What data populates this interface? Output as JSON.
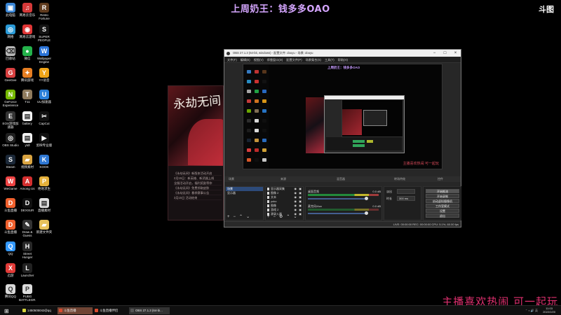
{
  "overlay": {
    "title": "上周奶王：钱多多OAO",
    "brand": "斗图",
    "footer": "主播喜欢热闹 可一起玩"
  },
  "desktop_icons": [
    {
      "label": "此电脑",
      "color": "#3b87d6",
      "icon": "computer-icon"
    },
    {
      "label": "网易云音乐",
      "color": "#d53939",
      "icon": "music-icon"
    },
    {
      "label": "Resto Fortune",
      "color": "#5f3b1e",
      "icon": "game-icon"
    },
    {
      "label": "网络",
      "color": "#2b9bd8",
      "icon": "network-icon"
    },
    {
      "label": "网易云游戏",
      "color": "#e03636",
      "icon": "cloud-game-icon"
    },
    {
      "label": "SUPER PEOPLE CBT",
      "color": "#141414",
      "icon": "game-icon"
    },
    {
      "label": "回收站",
      "color": "#b7b7b7",
      "icon": "recycle-bin-icon"
    },
    {
      "label": "微信",
      "color": "#24b24b",
      "icon": "wechat-icon"
    },
    {
      "label": "Wallpaper Engine",
      "color": "#2b73d6",
      "icon": "wallpaper-icon"
    },
    {
      "label": "GeeGee",
      "color": "#d84040",
      "icon": "app-icon"
    },
    {
      "label": "腾讯游戏",
      "color": "#e67e22",
      "icon": "game-icon"
    },
    {
      "label": "YY语音",
      "color": "#f0a518",
      "icon": "voice-icon"
    },
    {
      "label": "GeForce Experience",
      "color": "#76b900",
      "icon": "nvidia-icon"
    },
    {
      "label": "T11",
      "color": "#8f7b5d",
      "icon": "app-icon"
    },
    {
      "label": "UU加速器",
      "color": "#2a7fd8",
      "icon": "accelerator-icon"
    },
    {
      "label": "EOS游戏加速器",
      "color": "#333",
      "icon": "accelerator-icon"
    },
    {
      "label": "battery",
      "color": "#f2f2f2",
      "icon": "file-icon"
    },
    {
      "label": "CapCut",
      "color": "#111",
      "icon": "video-icon"
    },
    {
      "label": "OBS Studio",
      "color": "#202020",
      "icon": "obs-icon"
    },
    {
      "label": "ytdl",
      "color": "#f2f2f2",
      "icon": "file-icon"
    },
    {
      "label": "剪映专业版",
      "color": "#111",
      "icon": "video-icon"
    },
    {
      "label": "Steam",
      "color": "#1b2838",
      "icon": "steam-icon"
    },
    {
      "label": "视频素材",
      "color": "#d9a441",
      "icon": "folder-icon"
    },
    {
      "label": "KOOK",
      "color": "#2e77d3",
      "icon": "chat-icon"
    },
    {
      "label": "WeGame",
      "color": "#e44",
      "icon": "game-icon"
    },
    {
      "label": "Among Us",
      "color": "#d32f2f",
      "icon": "game-icon"
    },
    {
      "label": "绝地求生",
      "color": "#e5b13b",
      "icon": "game-icon"
    },
    {
      "label": "斗鱼直播",
      "color": "#f0602d",
      "icon": "live-icon"
    },
    {
      "label": "DEXSUR",
      "color": "#111",
      "icon": "game-icon"
    },
    {
      "label": "直播素材",
      "color": "#ddd",
      "icon": "file-icon"
    },
    {
      "label": "斗鱼直播",
      "color": "#f0602d",
      "icon": "live-icon"
    },
    {
      "label": "Draw & Guess",
      "color": "#333",
      "icon": "game-icon"
    },
    {
      "label": "新建文件夹",
      "color": "#e7c15b",
      "icon": "folder-icon"
    },
    {
      "label": "QQ",
      "color": "#3399ff",
      "icon": "qq-icon"
    },
    {
      "label": "Street Hunger",
      "color": "#282828",
      "icon": "game-icon"
    },
    {
      "label": "迅游",
      "color": "#e23b38",
      "icon": "accelerator-icon"
    },
    {
      "label": "Launcher",
      "color": "#222",
      "icon": "launcher-icon"
    },
    {
      "label": "腾讯QQ",
      "color": "#d9d9d9",
      "icon": "qq-icon"
    },
    {
      "label": "PUBG BATTLEGR...",
      "color": "#ddd",
      "icon": "game-icon"
    }
  ],
  "poster": {
    "calligraphy": "永劫无间",
    "lines": [
      "《永劫无间》新版本活动开启",
      "2月15日：新英雄、新武器上线",
      "全服活动开启，福利奖励等你",
      "《永劫无间》免费领取皮肤",
      "《永劫无间》春季赛事公告",
      "3月15日 活动结束"
    ]
  },
  "obs": {
    "title": "OBS 27.1.3 (64-bit, windows) - 配置文件: douyu - 场景: douyu",
    "menu": [
      "文件(F)",
      "编辑(E)",
      "视图(V)",
      "停靠窗口(D)",
      "配置文件(P)",
      "场景集合(S)",
      "工具(T)",
      "帮助(H)"
    ],
    "dock_titles": {
      "scenes": "场景",
      "sources": "来源",
      "mixer": "混音器",
      "transitions": "转场特效",
      "controls": "控件"
    },
    "scenes": [
      "场景",
      "显示器"
    ],
    "sources": [
      "显示器采集",
      "图像 2",
      "文本",
      "yoko",
      "图像",
      "游戏 2",
      "源录入器"
    ],
    "mixer": [
      {
        "name": "桌面音频",
        "db": "0.0 dB"
      },
      {
        "name": "麦克风/Aux",
        "db": "0.0 dB"
      }
    ],
    "transition": {
      "type_label": "淡出",
      "duration_label": "时长",
      "duration": "300 ms"
    },
    "controls": [
      "开始推流",
      "开始录制",
      "启动虚拟摄像机",
      "工作室模式",
      "设置",
      "退出"
    ],
    "status": "LIVE: 00:00:00   REC: 00:00:00   CPU: 5.1%, 60.00 fps"
  },
  "taskbar": {
    "items": [
      {
        "label": "1450505042@qq",
        "color": "#d6d33c"
      },
      {
        "label": "斗鱼直播",
        "color": "#d84b2f"
      },
      {
        "label": "斗鱼直播伴侣",
        "color": "#d84b2f"
      },
      {
        "label": "OBS 27.1.3 (64-bi...",
        "color": "#333"
      }
    ],
    "time": "11:03",
    "date": "2022/2/20"
  }
}
